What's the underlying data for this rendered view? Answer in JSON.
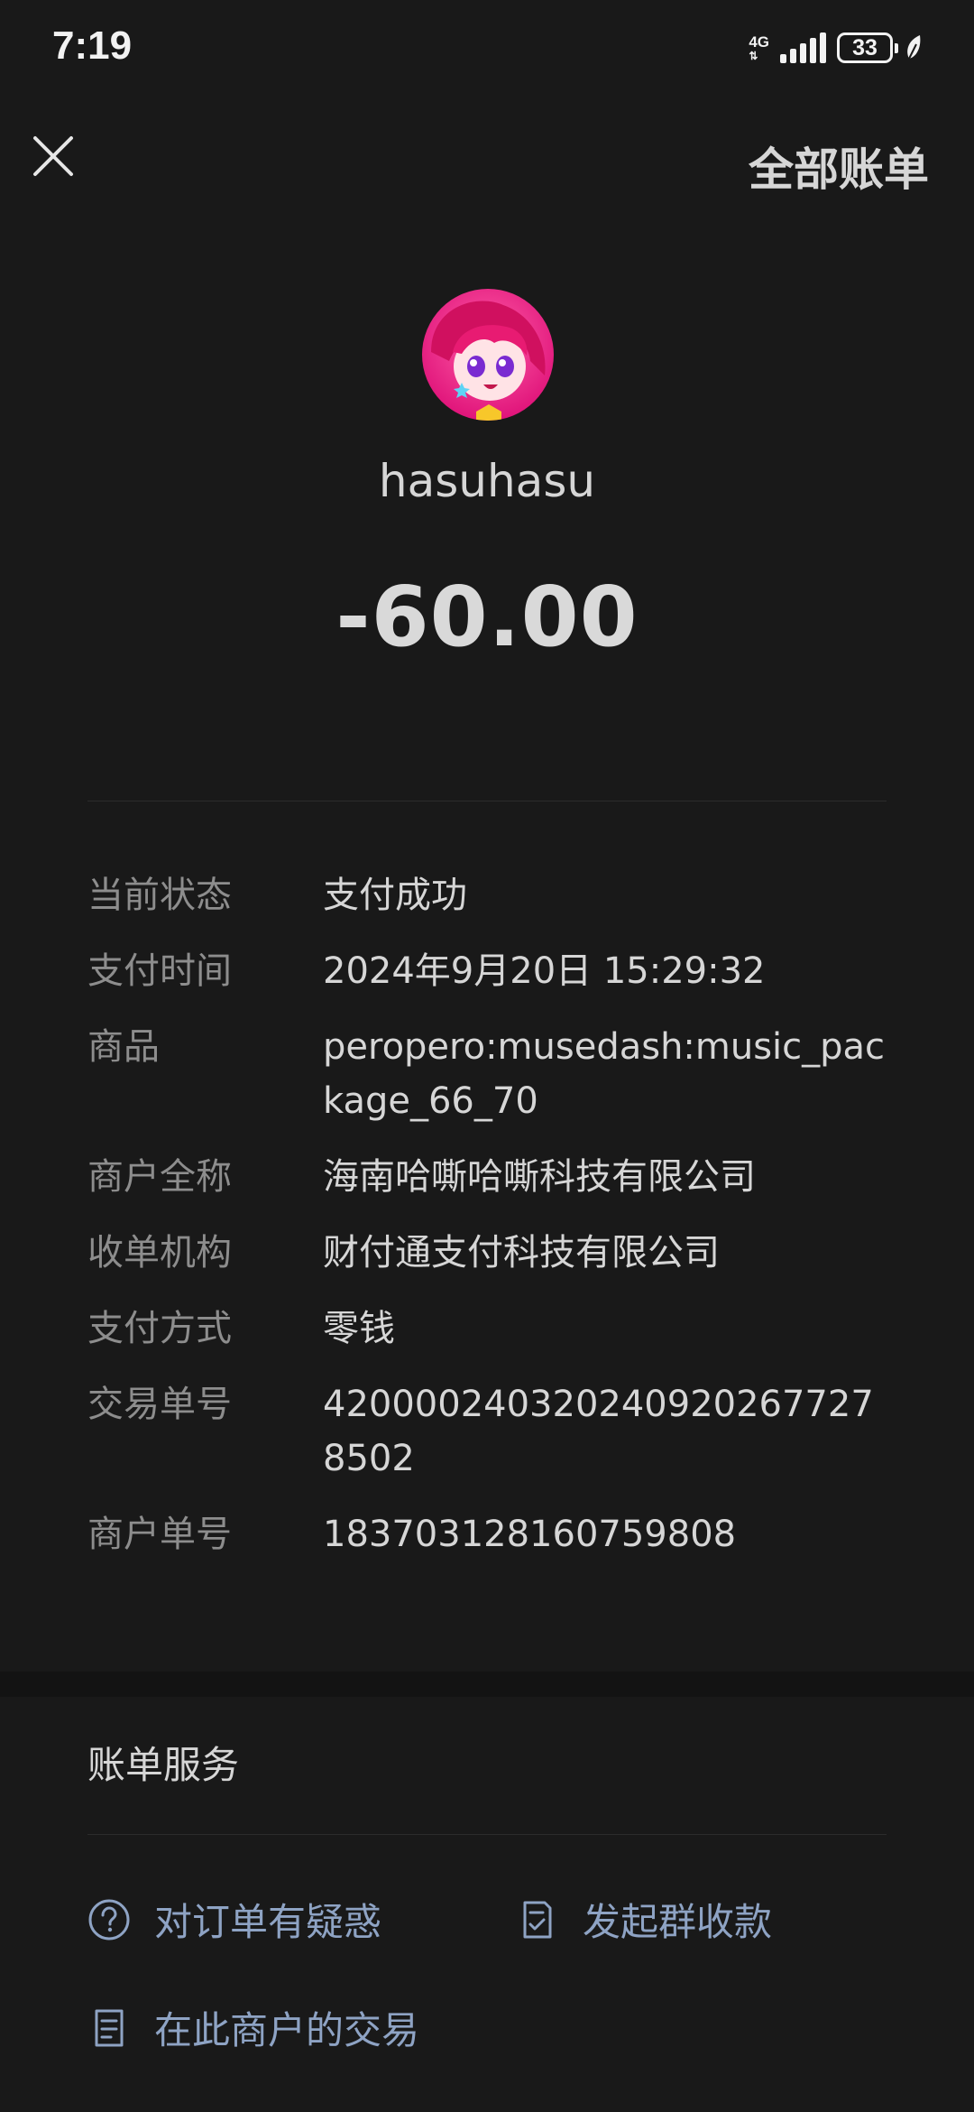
{
  "status_bar": {
    "time": "7:19",
    "network": "4G",
    "battery_level": "33"
  },
  "header": {
    "close_icon": "close-icon",
    "all_bills_label": "全部账单"
  },
  "merchant": {
    "name": "hasuhasu",
    "avatar": "anime-character-avatar",
    "amount": "-60.00"
  },
  "details": [
    {
      "label": "当前状态",
      "value": "支付成功"
    },
    {
      "label": "支付时间",
      "value": "2024年9月20日 15:29:32"
    },
    {
      "label": "商品",
      "value": "peropero:musedash:music_package_66_70"
    },
    {
      "label": "商户全称",
      "value": "海南哈嘶哈嘶科技有限公司"
    },
    {
      "label": "收单机构",
      "value": "财付通支付科技有限公司"
    },
    {
      "label": "支付方式",
      "value": "零钱"
    },
    {
      "label": "交易单号",
      "value": "4200002403202409202677278502"
    },
    {
      "label": "商户单号",
      "value": "183703128160759808"
    }
  ],
  "service": {
    "title": "账单服务",
    "links": [
      {
        "label": "对订单有疑惑",
        "icon": "question-circle-icon"
      },
      {
        "label": "发起群收款",
        "icon": "clipboard-check-icon"
      },
      {
        "label": "在此商户的交易",
        "icon": "document-icon"
      }
    ]
  },
  "colors": {
    "background": "#191919",
    "link": "#8ea3c4",
    "label": "#8d8d8d",
    "text": "#d6d6d6"
  }
}
